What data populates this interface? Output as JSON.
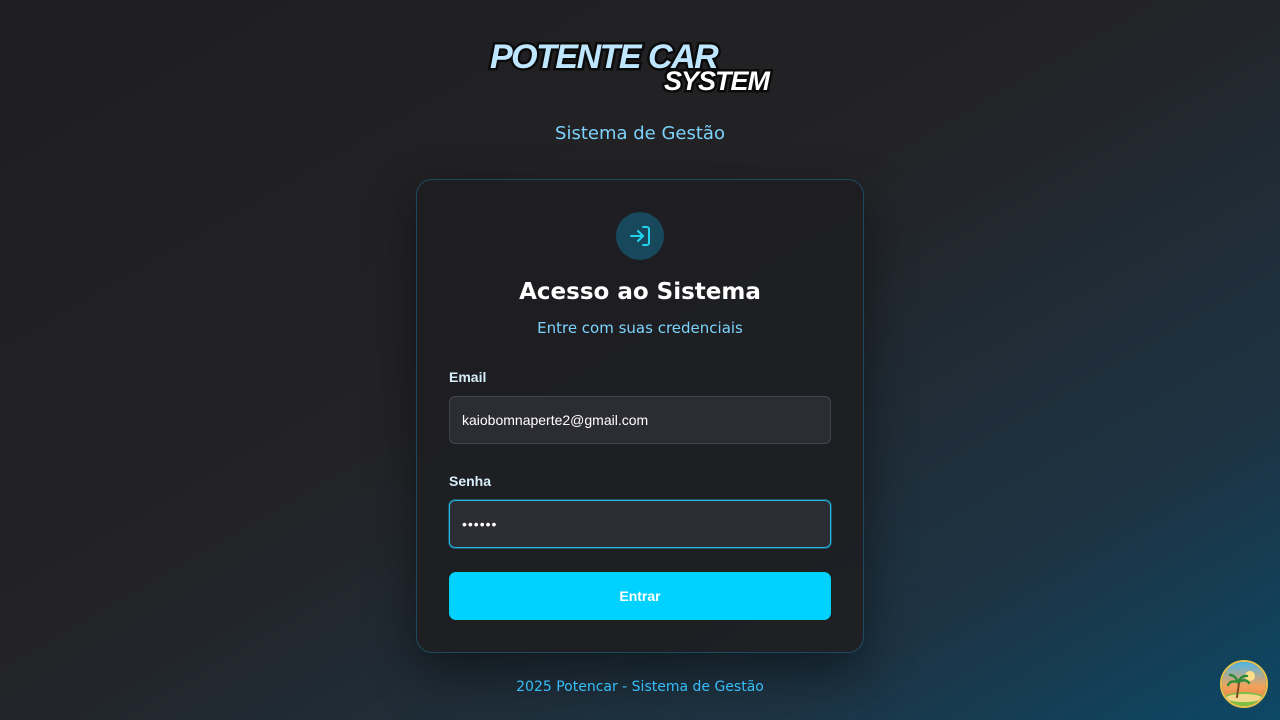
{
  "logo": {
    "line1": "POTENTE CAR",
    "line2": "SYSTEM"
  },
  "header": {
    "subtitle": "Sistema de Gestão"
  },
  "card": {
    "icon": "login-arrow-icon",
    "title": "Acesso ao Sistema",
    "subtitle": "Entre com suas credenciais"
  },
  "form": {
    "email_label": "Email",
    "email_value": "kaiobomnaperte2@gmail.com",
    "password_label": "Senha",
    "password_masked": "••••••",
    "submit_label": "Entrar"
  },
  "footer": {
    "text": "2025 Potencar - Sistema de Gestão"
  },
  "colors": {
    "accent": "#00d2ff",
    "accent_text": "#7dd3fc",
    "card_bg": "#1e1e22",
    "input_bg": "#2c2c33"
  }
}
